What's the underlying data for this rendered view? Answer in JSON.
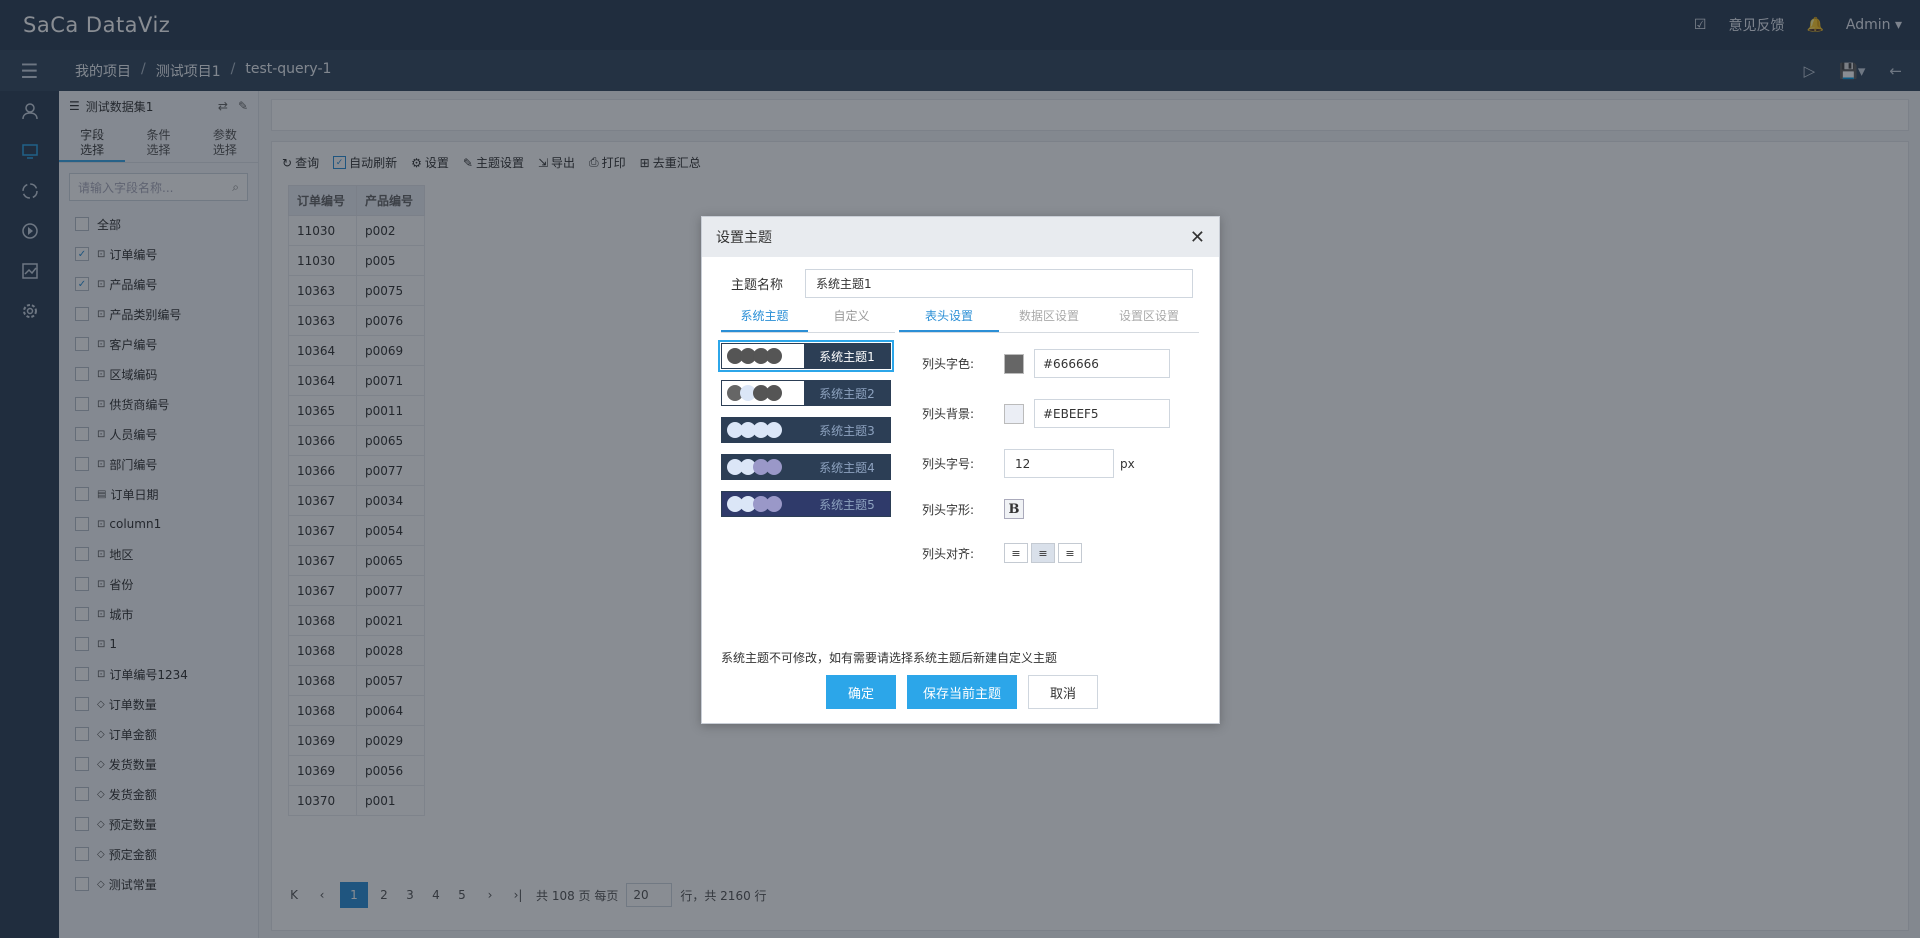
{
  "app": {
    "logo": "SaCa DataViz"
  },
  "topbar": {
    "feedback": "意见反馈",
    "user": "Admin"
  },
  "breadcrumb": [
    "我的项目",
    "测试项目1",
    "test-query-1"
  ],
  "sidebar": {
    "dataset": "测试数据集1",
    "tabs": [
      "字段\n选择",
      "条件\n选择",
      "参数\n选择"
    ],
    "search_placeholder": "请输入字段名称...",
    "fields": [
      {
        "label": "全部",
        "checked": false,
        "type": ""
      },
      {
        "label": "订单编号",
        "checked": true,
        "type": "dim"
      },
      {
        "label": "产品编号",
        "checked": true,
        "type": "dim"
      },
      {
        "label": "产品类别编号",
        "checked": false,
        "type": "dim"
      },
      {
        "label": "客户编号",
        "checked": false,
        "type": "dim"
      },
      {
        "label": "区域编码",
        "checked": false,
        "type": "dim"
      },
      {
        "label": "供货商编号",
        "checked": false,
        "type": "dim"
      },
      {
        "label": "人员编号",
        "checked": false,
        "type": "dim"
      },
      {
        "label": "部门编号",
        "checked": false,
        "type": "dim"
      },
      {
        "label": "订单日期",
        "checked": false,
        "type": "date"
      },
      {
        "label": "column1",
        "checked": false,
        "type": "dim"
      },
      {
        "label": "地区",
        "checked": false,
        "type": "dim"
      },
      {
        "label": "省份",
        "checked": false,
        "type": "dim"
      },
      {
        "label": "城市",
        "checked": false,
        "type": "dim"
      },
      {
        "label": "1",
        "checked": false,
        "type": "dim"
      },
      {
        "label": "订单编号1234",
        "checked": false,
        "type": "dim"
      },
      {
        "label": "订单数量",
        "checked": false,
        "type": "measure"
      },
      {
        "label": "订单金额",
        "checked": false,
        "type": "measure"
      },
      {
        "label": "发货数量",
        "checked": false,
        "type": "measure"
      },
      {
        "label": "发货金额",
        "checked": false,
        "type": "measure"
      },
      {
        "label": "预定数量",
        "checked": false,
        "type": "measure"
      },
      {
        "label": "预定金额",
        "checked": false,
        "type": "measure"
      },
      {
        "label": "测试常量",
        "checked": false,
        "type": "measure"
      }
    ]
  },
  "toolbar": {
    "query": "查询",
    "auto_refresh": "自动刷新",
    "settings": "设置",
    "theme": "主题设置",
    "export": "导出",
    "print": "打印",
    "dedupe": "去重汇总"
  },
  "table": {
    "headers": [
      "订单编号",
      "产品编号"
    ],
    "rows": [
      [
        "11030",
        "p002"
      ],
      [
        "11030",
        "p005"
      ],
      [
        "10363",
        "p0075"
      ],
      [
        "10363",
        "p0076"
      ],
      [
        "10364",
        "p0069"
      ],
      [
        "10364",
        "p0071"
      ],
      [
        "10365",
        "p0011"
      ],
      [
        "10366",
        "p0065"
      ],
      [
        "10366",
        "p0077"
      ],
      [
        "10367",
        "p0034"
      ],
      [
        "10367",
        "p0054"
      ],
      [
        "10367",
        "p0065"
      ],
      [
        "10367",
        "p0077"
      ],
      [
        "10368",
        "p0021"
      ],
      [
        "10368",
        "p0028"
      ],
      [
        "10368",
        "p0057"
      ],
      [
        "10368",
        "p0064"
      ],
      [
        "10369",
        "p0029"
      ],
      [
        "10369",
        "p0056"
      ],
      [
        "10370",
        "p001"
      ]
    ]
  },
  "pager": {
    "pages": [
      "1",
      "2",
      "3",
      "4",
      "5"
    ],
    "current": "1",
    "total_pages_text": "共 108 页 每页",
    "page_size": "20",
    "total_rows_text": "行，共 2160 行"
  },
  "dialog": {
    "title": "设置主题",
    "name_label": "主题名称",
    "name_value": "系统主题1",
    "left_tabs": [
      "系统主题",
      "自定义"
    ],
    "right_tabs": [
      "表头设置",
      "数据区设置",
      "设置区设置"
    ],
    "themes": [
      {
        "label": "系统主题1",
        "bg": "#ffffff",
        "labelbg": "#2c3e55",
        "labelcolor": "#ffffff",
        "dots": [
          "#555555",
          "#555555",
          "#555555",
          "#555555"
        ]
      },
      {
        "label": "系统主题2",
        "bg": "#ffffff",
        "labelbg": "#2c3e55",
        "labelcolor": "#8da2bf",
        "dots": [
          "#666666",
          "#dbe6f7",
          "#555555",
          "#555555"
        ]
      },
      {
        "label": "系统主题3",
        "bg": "#2c3e55",
        "labelbg": "#2c3e55",
        "labelcolor": "#8da2bf",
        "dots": [
          "#dbe6f7",
          "#dbe6f7",
          "#dbe6f7",
          "#dbe6f7"
        ]
      },
      {
        "label": "系统主题4",
        "bg": "#2c3e55",
        "labelbg": "#2c3e55",
        "labelcolor": "#8da2bf",
        "dots": [
          "#dbe6f7",
          "#dbe6f7",
          "#9a98c8",
          "#9a98c8"
        ]
      },
      {
        "label": "系统主题5",
        "bg": "#2f3a6a",
        "labelbg": "#2f3a6a",
        "labelcolor": "#8da2bf",
        "dots": [
          "#dbe6f7",
          "#dbe6f7",
          "#9a98c8",
          "#9a98c8"
        ]
      }
    ],
    "header_color_label": "列头字色:",
    "header_color": "#666666",
    "header_bg_label": "列头背景:",
    "header_bg": "#EBEEF5",
    "header_size_label": "列头字号:",
    "header_size": "12",
    "header_size_unit": "px",
    "header_style_label": "列头字形:",
    "header_style_bold": "B",
    "header_align_label": "列头对齐:",
    "align_selected": "center",
    "note": "系统主题不可修改，如有需要请选择系统主题后新建自定义主题",
    "ok": "确定",
    "save_current": "保存当前主题",
    "cancel": "取消"
  },
  "colors": {
    "accent": "#2ca6e9",
    "topbar": "#2c3e55"
  }
}
